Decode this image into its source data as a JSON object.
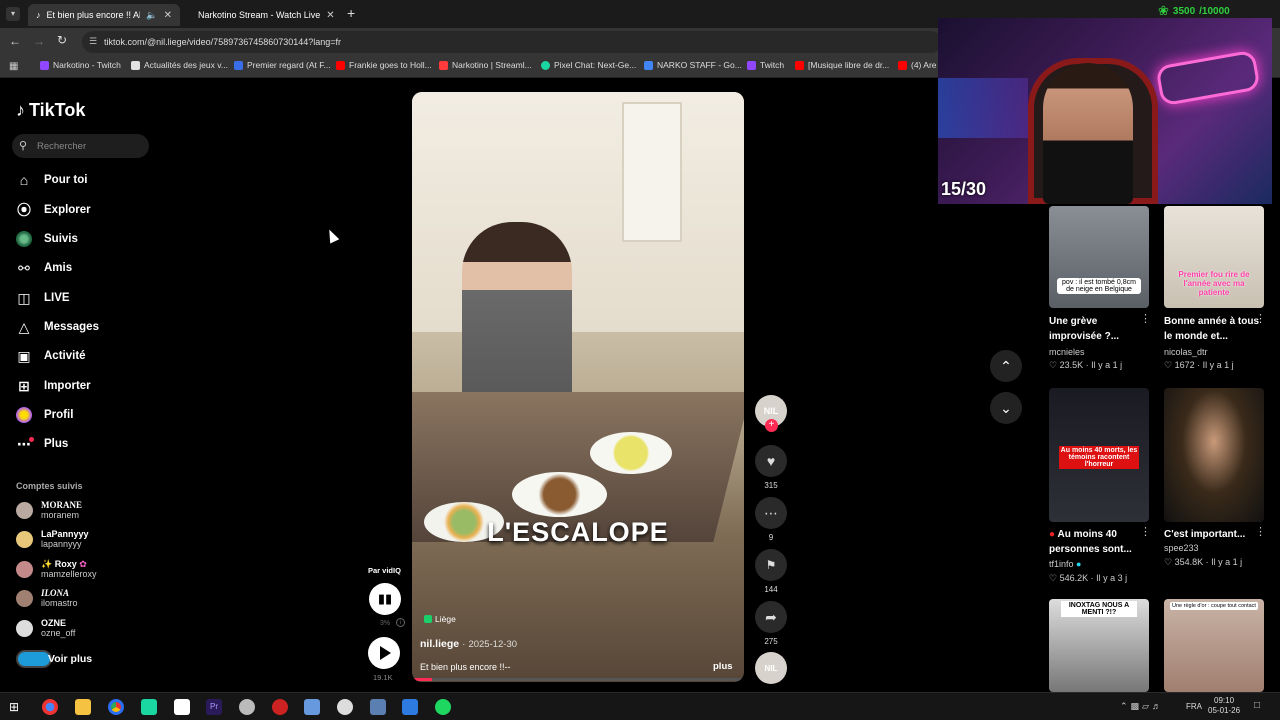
{
  "browser": {
    "tabs": [
      {
        "label": "Et bien plus encore !! Alors",
        "active": true
      },
      {
        "label": "Narkotino Stream - Watch Live",
        "active": false
      }
    ],
    "new_tab": "+",
    "url": "tiktok.com/@nil.liege/video/7589736745860730144?lang=fr",
    "bookmarks": [
      {
        "label": "Narkotino - Twitch",
        "color": "#9146ff"
      },
      {
        "label": "Actualités des jeux v...",
        "color": "#e2e2e2"
      },
      {
        "label": "Premier regard (At F...",
        "color": "#3a6ee8"
      },
      {
        "label": "Frankie goes to Holl...",
        "color": "#ff0000"
      },
      {
        "label": "Narkotino | Streaml...",
        "color": "#ff3b3b"
      },
      {
        "label": "Pixel Chat: Next-Ge...",
        "color": "#1ad6a0"
      },
      {
        "label": "NARKO STAFF - Go...",
        "color": "#4285f4"
      },
      {
        "label": "Twitch",
        "color": "#9146ff"
      },
      {
        "label": "[Musique libre de dr...",
        "color": "#ff0000"
      },
      {
        "label": "(4) Are",
        "color": "#ff0000"
      }
    ]
  },
  "tiktok": {
    "logo": "TikTok",
    "search_placeholder": "Rechercher",
    "nav": [
      {
        "label": "Pour toi",
        "icon": "home-icon"
      },
      {
        "label": "Explorer",
        "icon": "compass-icon"
      },
      {
        "label": "Suivis",
        "icon": "following-icon"
      },
      {
        "label": "Amis",
        "icon": "friends-icon"
      },
      {
        "label": "LIVE",
        "icon": "live-icon"
      },
      {
        "label": "Messages",
        "icon": "messages-icon"
      },
      {
        "label": "Activité",
        "icon": "activity-icon"
      },
      {
        "label": "Importer",
        "icon": "upload-icon"
      },
      {
        "label": "Profil",
        "icon": "profile-icon"
      },
      {
        "label": "Plus",
        "icon": "more-icon"
      }
    ],
    "followed_title": "Comptes suivis",
    "accounts": [
      {
        "display": "MORANE",
        "handle": "moranem"
      },
      {
        "display": "LaPannyyy",
        "handle": "lapannyyy"
      },
      {
        "display": "Roxy",
        "handle": "mamzelleroxy"
      },
      {
        "display": "ILONA",
        "handle": "ilomastro"
      },
      {
        "display": "OZNE",
        "handle": "ozne_off"
      }
    ],
    "see_more": "Voir plus",
    "video": {
      "overlay_text": "L'ESCALOPE",
      "location": "Liège",
      "author": "nil.liege",
      "date": "2025-12-30",
      "caption": "Et bien plus encore !!--",
      "more": "plus",
      "vidiq_label": "Par vidIQ",
      "vidiq_pct": "3%",
      "vidiq_views": "19.1K"
    },
    "actions": {
      "avatar_label": "nil",
      "likes": "315",
      "comments": "9",
      "saves": "144",
      "shares": "275"
    }
  },
  "overlay": {
    "counter": "15/30",
    "points": "3500",
    "goal": "/10000"
  },
  "related": [
    {
      "overlay": "pov : il est tombé 0,8cm de neige en Belgique",
      "title": "Une grève improvisée ?...",
      "user": "mcnieles",
      "likes": "23.5K",
      "age": "Il y a 1 j"
    },
    {
      "overlay": "Premier fou rire de l'année avec ma patiente",
      "title": "Bonne année à tous le monde et...",
      "user": "nicolas_dtr",
      "likes": "1672",
      "age": "Il y a 1 j"
    },
    {
      "overlay": "Au moins 40 morts, les témoins racontent l'horreur",
      "title": "Au moins 40 personnes sont...",
      "user": "tf1info",
      "likes": "546.2K",
      "age": "Il y a 3 j"
    },
    {
      "overlay": "",
      "title": "C'est important...",
      "user": "spee233",
      "likes": "354.8K",
      "age": "Il y a 1 j"
    },
    {
      "overlay": "INOXTAG NOUS A MENTI ?!?",
      "title": "",
      "user": "",
      "likes": "",
      "age": ""
    },
    {
      "overlay": "Une règle d'or : coupe tout contact",
      "title": "",
      "user": "",
      "likes": "",
      "age": ""
    }
  ],
  "taskbar": {
    "lang": "FRA",
    "time": "09:10",
    "date": "05-01-26"
  }
}
